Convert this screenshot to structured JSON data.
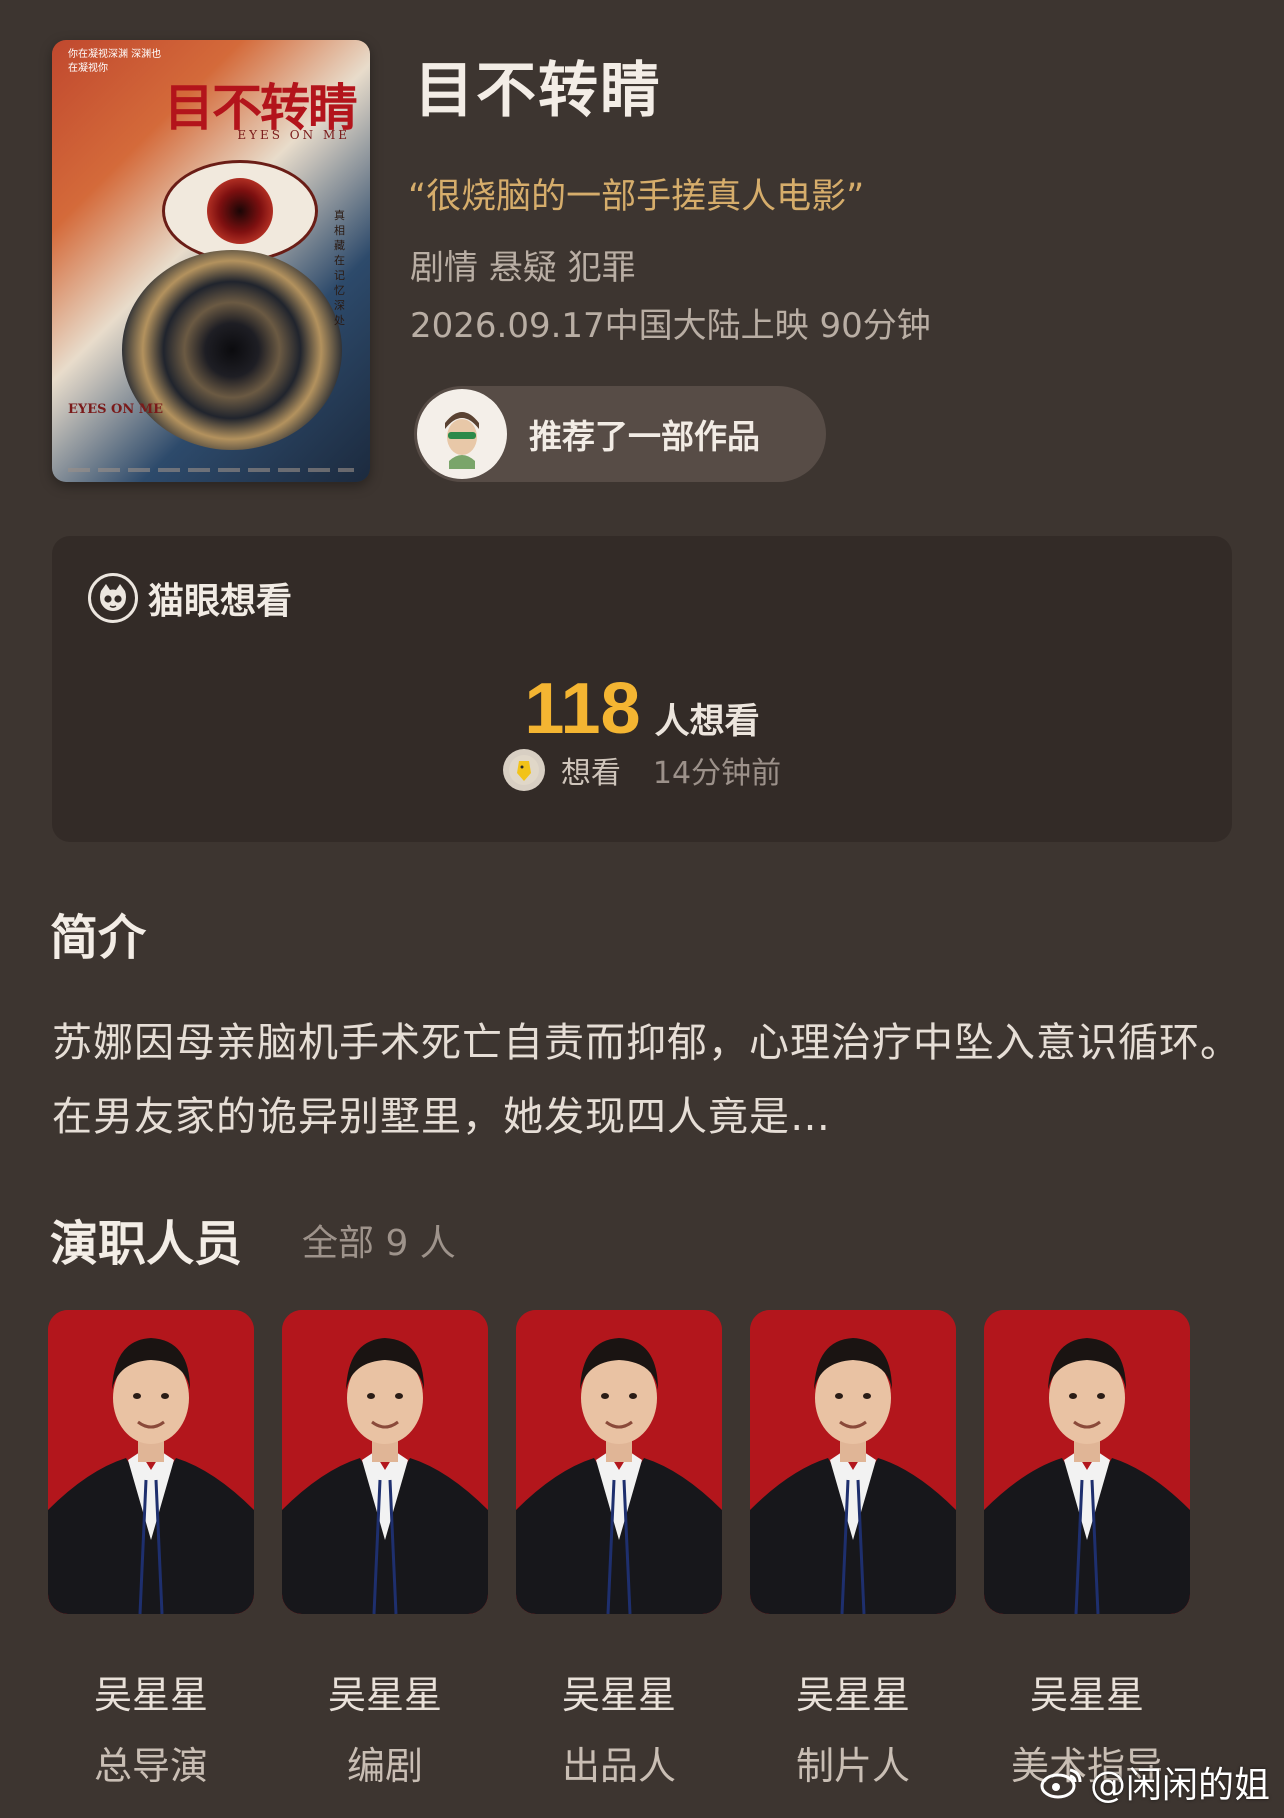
{
  "poster": {
    "tagline": "你在凝视深渊 深渊也在凝视你",
    "title": "目不转睛",
    "subtitle": "EYES ON ME",
    "side_text": "真相藏在记忆深处",
    "footer": "EYES ON ME"
  },
  "movie": {
    "title": "目不转睛",
    "quote": "“很烧脑的一部手搓真人电影”",
    "genres": "剧情 悬疑 犯罪",
    "release": "2026.09.17中国大陆上映 90分钟"
  },
  "recommend": {
    "label": "推荐了一部作品",
    "avatar_icon": "user-avatar-icon"
  },
  "want": {
    "brand": "猫眼想看",
    "brand_icon": "cat-logo-icon",
    "count": "118",
    "unit": "人想看",
    "recent_label": "想看",
    "recent_time": "14分钟前",
    "accent": "#f4b532"
  },
  "synopsis": {
    "title": "简介",
    "text": "苏娜因母亲脑机手术死亡自责而抑郁，心理治疗中坠入意识循环。在男友家的诡异别墅里，她发现四人竟是…"
  },
  "cast": {
    "title": "演职人员",
    "count": "全部 9 人",
    "members": [
      {
        "name": "吴星星",
        "role": "总导演"
      },
      {
        "name": "吴星星",
        "role": "编剧"
      },
      {
        "name": "吴星星",
        "role": "出品人"
      },
      {
        "name": "吴星星",
        "role": "制片人"
      },
      {
        "name": "吴星星",
        "role": "美术指导"
      }
    ]
  },
  "watermark": {
    "text": "@闲闲的姐",
    "icon": "weibo-icon"
  }
}
